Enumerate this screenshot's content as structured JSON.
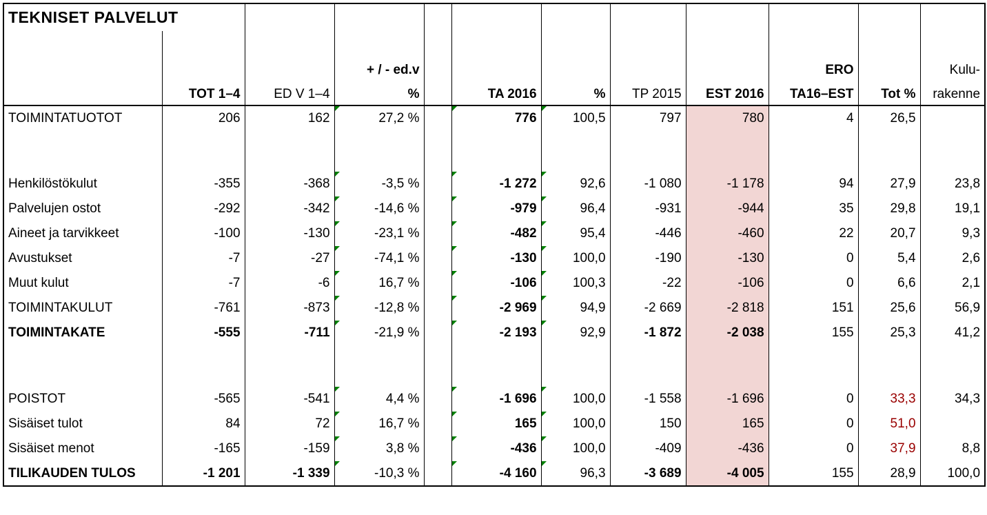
{
  "title": "TEKNISET PALVELUT",
  "headers": {
    "h_row1": {
      "c3a": "+ / - ed.v",
      "c9a": "ERO",
      "c11a": "Kulu-"
    },
    "h_row2": {
      "c1": "TOT 1–4",
      "c2": "ED V 1–4",
      "c3": "%",
      "c5": "TA 2016",
      "c6": "%",
      "c7": "TP 2015",
      "c8": "EST 2016",
      "c9": "TA16–EST",
      "c10": "Tot %",
      "c11": "rakenne"
    }
  },
  "rows": {
    "r0": {
      "label": "TOIMINTATUOTOT",
      "c1": "206",
      "c2": "162",
      "c3": "27,2 %",
      "c5": "776",
      "c6": "100,5",
      "c7": "797",
      "c8": "780",
      "c9": "4",
      "c10": "26,5",
      "c11": ""
    },
    "r1": {
      "label": "Henkilöstökulut",
      "c1": "-355",
      "c2": "-368",
      "c3": "-3,5 %",
      "c5": "-1 272",
      "c6": "92,6",
      "c7": "-1 080",
      "c8": "-1 178",
      "c9": "94",
      "c10": "27,9",
      "c11": "23,8"
    },
    "r2": {
      "label": "Palvelujen ostot",
      "c1": "-292",
      "c2": "-342",
      "c3": "-14,6 %",
      "c5": "-979",
      "c6": "96,4",
      "c7": "-931",
      "c8": "-944",
      "c9": "35",
      "c10": "29,8",
      "c11": "19,1"
    },
    "r3": {
      "label": "Aineet ja tarvikkeet",
      "c1": "-100",
      "c2": "-130",
      "c3": "-23,1 %",
      "c5": "-482",
      "c6": "95,4",
      "c7": "-446",
      "c8": "-460",
      "c9": "22",
      "c10": "20,7",
      "c11": "9,3"
    },
    "r4": {
      "label": "Avustukset",
      "c1": "-7",
      "c2": "-27",
      "c3": "-74,1 %",
      "c5": "-130",
      "c6": "100,0",
      "c7": "-190",
      "c8": "-130",
      "c9": "0",
      "c10": "5,4",
      "c11": "2,6"
    },
    "r5": {
      "label": "Muut kulut",
      "c1": "-7",
      "c2": "-6",
      "c3": "16,7 %",
      "c5": "-106",
      "c6": "100,3",
      "c7": "-22",
      "c8": "-106",
      "c9": "0",
      "c10": "6,6",
      "c11": "2,1"
    },
    "r6": {
      "label": "TOIMINTAKULUT",
      "c1": "-761",
      "c2": "-873",
      "c3": "-12,8 %",
      "c5": "-2 969",
      "c6": "94,9",
      "c7": "-2 669",
      "c8": "-2 818",
      "c9": "151",
      "c10": "25,6",
      "c11": "56,9"
    },
    "r7": {
      "label": "TOIMINTAKATE",
      "c1": "-555",
      "c2": "-711",
      "c3": "-21,9 %",
      "c5": "-2 193",
      "c6": "92,9",
      "c7": "-1 872",
      "c8": "-2 038",
      "c9": "155",
      "c10": "25,3",
      "c11": "41,2"
    },
    "r8": {
      "label": "POISTOT",
      "c1": "-565",
      "c2": "-541",
      "c3": "4,4 %",
      "c5": "-1 696",
      "c6": "100,0",
      "c7": "-1 558",
      "c8": "-1 696",
      "c9": "0",
      "c10": "33,3",
      "c11": "34,3"
    },
    "r9": {
      "label": "Sisäiset tulot",
      "c1": "84",
      "c2": "72",
      "c3": "16,7 %",
      "c5": "165",
      "c6": "100,0",
      "c7": "150",
      "c8": "165",
      "c9": "0",
      "c10": "51,0",
      "c11": ""
    },
    "r10": {
      "label": "Sisäiset menot",
      "c1": "-165",
      "c2": "-159",
      "c3": "3,8 %",
      "c5": "-436",
      "c6": "100,0",
      "c7": "-409",
      "c8": "-436",
      "c9": "0",
      "c10": "37,9",
      "c11": "8,8"
    },
    "r11": {
      "label": "TILIKAUDEN TULOS",
      "c1": "-1 201",
      "c2": "-1 339",
      "c3": "-10,3 %",
      "c5": "-4 160",
      "c6": "96,3",
      "c7": "-3 689",
      "c8": "-4 005",
      "c9": "155",
      "c10": "28,9",
      "c11": "100,0"
    }
  }
}
